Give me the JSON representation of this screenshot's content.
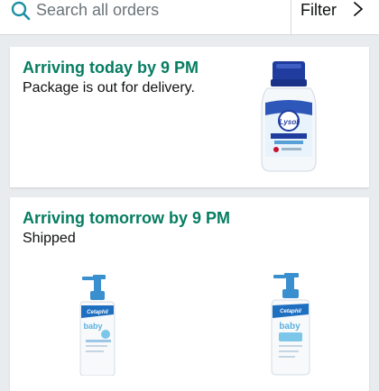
{
  "search": {
    "placeholder": "Search all orders",
    "icon": "search-icon"
  },
  "filter": {
    "label": "Filter",
    "icon": "chevron-right-icon"
  },
  "orders": [
    {
      "status": "Arriving today by 9 PM",
      "detail": "Package is out for delivery.",
      "products": [
        {
          "name": "Lysol laundry sanitizer bottle",
          "brand_text": "Lysol",
          "label_text": "Laundry Sanitizer"
        }
      ]
    },
    {
      "status": "Arriving tomorrow by 9 PM",
      "detail": "Shipped",
      "products": [
        {
          "name": "Cetaphil baby lotion pump bottle",
          "brand_text": "Cetaphil",
          "label_text": "baby"
        },
        {
          "name": "Cetaphil baby wash pump bottle",
          "brand_text": "Cetaphil",
          "label_text": "baby"
        }
      ]
    }
  ],
  "colors": {
    "accent_green": "#067d62",
    "search_icon": "#1d8fa3",
    "page_bg": "#e9ecef"
  }
}
